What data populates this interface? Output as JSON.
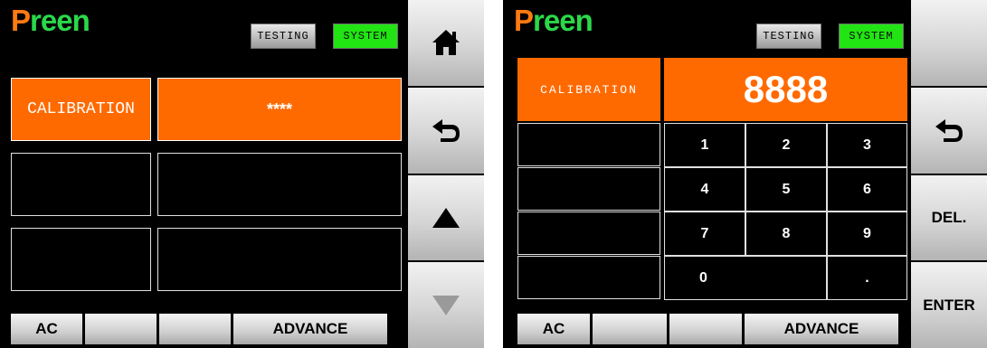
{
  "brand": "Preen",
  "modes": {
    "testing": "TESTING",
    "system": "SYSTEM"
  },
  "left_screen": {
    "rows": [
      {
        "label": "CALIBRATION",
        "value": "****"
      },
      {
        "label": "",
        "value": ""
      },
      {
        "label": "",
        "value": ""
      }
    ],
    "side_buttons": [
      "home-icon",
      "back-icon",
      "up-arrow-icon",
      "down-arrow-icon"
    ]
  },
  "right_screen": {
    "label": "CALIBRATION",
    "display_value": "8888",
    "keys": [
      "1",
      "2",
      "3",
      "4",
      "5",
      "6",
      "7",
      "8",
      "9",
      "0",
      "."
    ],
    "side_buttons": {
      "back": "back-icon",
      "delete": "DEL.",
      "enter": "ENTER"
    }
  },
  "bottom_bar": {
    "ac": "AC",
    "blank_1": "",
    "blank_2": "",
    "advance": "ADVANCE"
  },
  "colors": {
    "accent": "#ff6a00",
    "system_active": "#22e414",
    "brand_green": "#2bd84a"
  }
}
